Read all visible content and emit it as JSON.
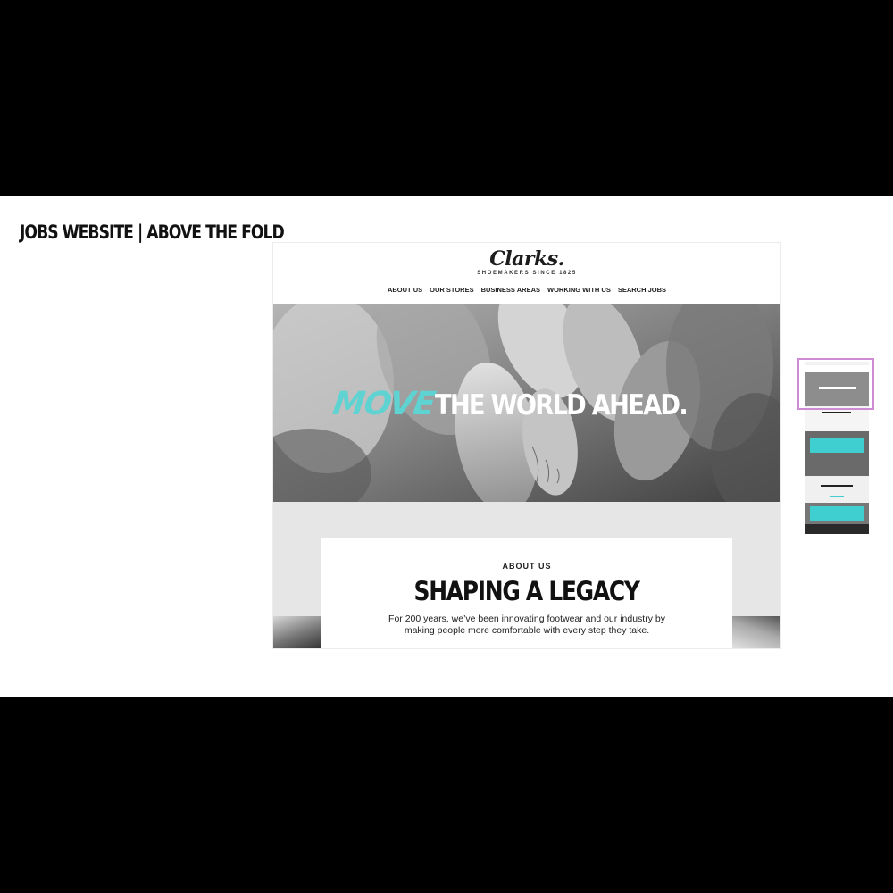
{
  "slide": {
    "title": "JOBS WEBSITE | ABOVE THE FOLD"
  },
  "site": {
    "logo": "Clarks.",
    "tagline": "SHOEMAKERS SINCE 1825",
    "nav": [
      "ABOUT US",
      "OUR STORES",
      "BUSINESS AREAS",
      "WORKING WITH US",
      "SEARCH JOBS"
    ]
  },
  "hero": {
    "headline_accent": "MOVE",
    "headline_main": "THE WORLD AHEAD."
  },
  "about": {
    "eyebrow": "ABOUT US",
    "heading": "SHAPING A LEGACY",
    "body": "For 200 years, we’ve been innovating footwear and our industry by making people more comfortable with every step they take."
  },
  "colors": {
    "accent": "#5fd2d2",
    "thumbnail_highlight": "#cf8ad6"
  }
}
